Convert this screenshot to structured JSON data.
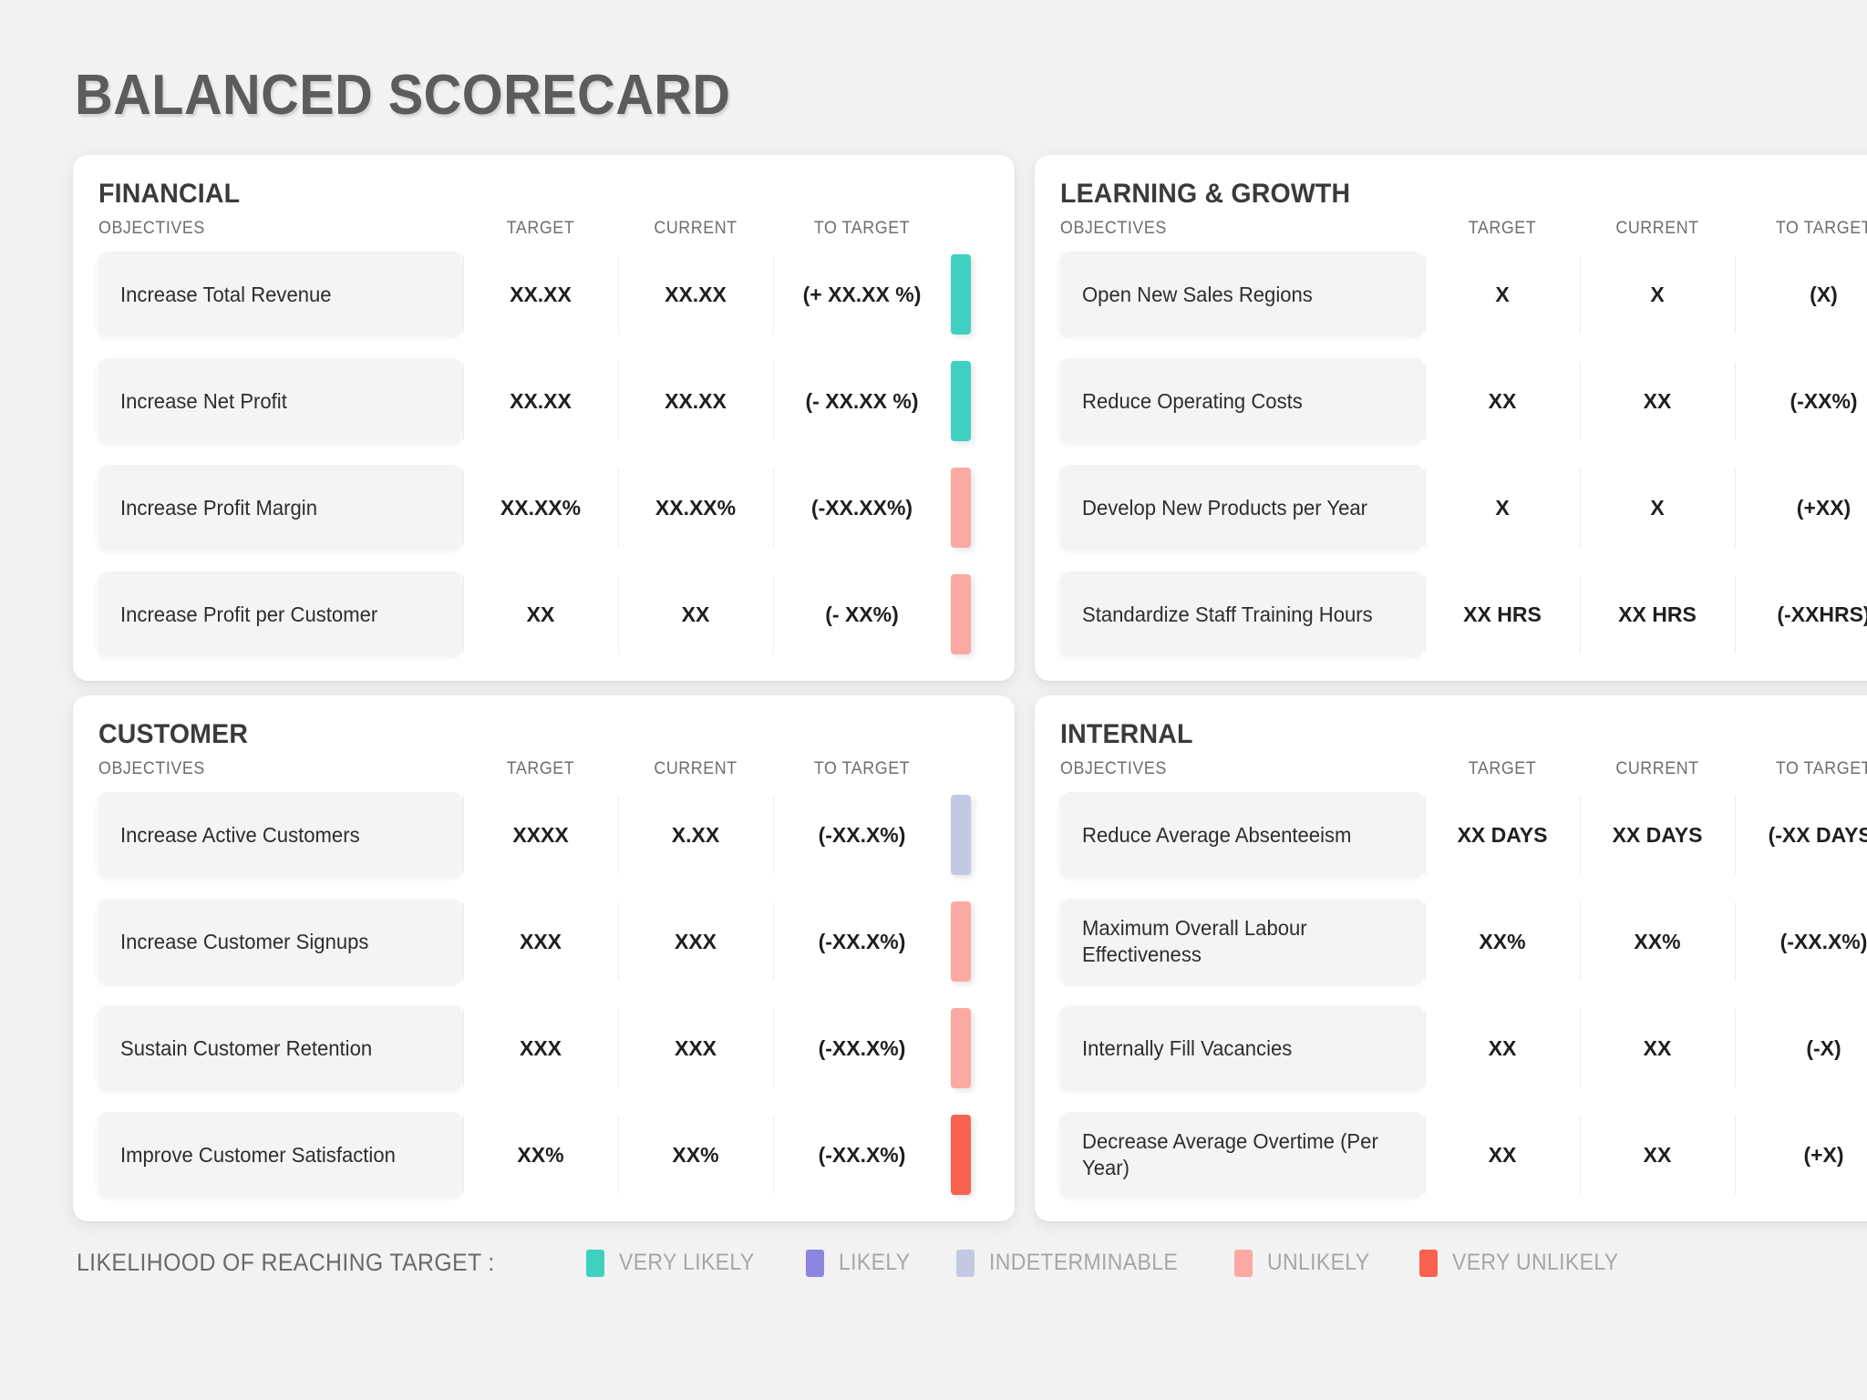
{
  "page_title": "BALANCED SCORECARD",
  "column_headers": {
    "objectives": "OBJECTIVES",
    "target": "TARGET",
    "current": "CURRENT",
    "to_target": "TO TARGET"
  },
  "status_colors": {
    "very_likely": "#3fd0c0",
    "likely": "#8b85e0",
    "indeterminable": "#c3c9e3",
    "unlikely": "#fca9a4",
    "very_unlikely": "#f9624e"
  },
  "panels": [
    {
      "id": "financial",
      "title": "FINANCIAL",
      "rows": [
        {
          "objective": "Increase Total Revenue",
          "target": "XX.XX",
          "current": "XX.XX",
          "to_target": "(+ XX.XX %)",
          "status": "very_likely"
        },
        {
          "objective": "Increase Net Profit",
          "target": "XX.XX",
          "current": "XX.XX",
          "to_target": "(- XX.XX %)",
          "status": "very_likely"
        },
        {
          "objective": "Increase Profit Margin",
          "target": "XX.XX%",
          "current": "XX.XX%",
          "to_target": "(-XX.XX%)",
          "status": "unlikely"
        },
        {
          "objective": "Increase Profit per Customer",
          "target": "XX",
          "current": "XX",
          "to_target": "(- XX%)",
          "status": "unlikely"
        }
      ]
    },
    {
      "id": "learning-growth",
      "title": "LEARNING & GROWTH",
      "rows": [
        {
          "objective": "Open New Sales Regions",
          "target": "X",
          "current": "X",
          "to_target": "(X)",
          "status": "very_likely"
        },
        {
          "objective": "Reduce Operating Costs",
          "target": "XX",
          "current": "XX",
          "to_target": "(-XX%)",
          "status": "very_unlikely"
        },
        {
          "objective": "Develop New Products per Year",
          "target": "X",
          "current": "X",
          "to_target": "(+XX)",
          "status": "very_likely"
        },
        {
          "objective": "Standardize Staff Training Hours",
          "target": "XX HRS",
          "current": "XX HRS",
          "to_target": "(-XXHRS)",
          "status": "very_unlikely"
        }
      ]
    },
    {
      "id": "customer",
      "title": "CUSTOMER",
      "rows": [
        {
          "objective": "Increase Active Customers",
          "target": "XXXX",
          "current": "X.XX",
          "to_target": "(-XX.X%)",
          "status": "indeterminable"
        },
        {
          "objective": "Increase Customer Signups",
          "target": "XXX",
          "current": "XXX",
          "to_target": "(-XX.X%)",
          "status": "unlikely"
        },
        {
          "objective": "Sustain Customer Retention",
          "target": "XXX",
          "current": "XXX",
          "to_target": "(-XX.X%)",
          "status": "unlikely"
        },
        {
          "objective": "Improve Customer Satisfaction",
          "target": "XX%",
          "current": "XX%",
          "to_target": "(-XX.X%)",
          "status": "very_unlikely"
        }
      ]
    },
    {
      "id": "internal",
      "title": "INTERNAL",
      "rows": [
        {
          "objective": "Reduce Average Absenteeism",
          "target": "XX DAYS",
          "current": "XX DAYS",
          "to_target": "(-XX DAYS)",
          "status": "very_unlikely"
        },
        {
          "objective": "Maximum Overall Labour Effectiveness",
          "target": "XX%",
          "current": "XX%",
          "to_target": "(-XX.X%)",
          "status": "very_unlikely"
        },
        {
          "objective": "Internally Fill Vacancies",
          "target": "XX",
          "current": "XX",
          "to_target": "(-X)",
          "status": "likely"
        },
        {
          "objective": "Decrease Average Overtime (Per Year)",
          "target": "XX",
          "current": "XX",
          "to_target": "(+X)",
          "status": "very_likely"
        }
      ]
    }
  ],
  "legend": {
    "title": "LIKELIHOOD OF REACHING TARGET :",
    "items": [
      {
        "label": "VERY LIKELY",
        "status": "very_likely"
      },
      {
        "label": "LIKELY",
        "status": "likely"
      },
      {
        "label": "INDETERMINABLE",
        "status": "indeterminable"
      },
      {
        "label": "UNLIKELY",
        "status": "unlikely"
      },
      {
        "label": "VERY UNLIKELY",
        "status": "very_unlikely"
      }
    ]
  }
}
